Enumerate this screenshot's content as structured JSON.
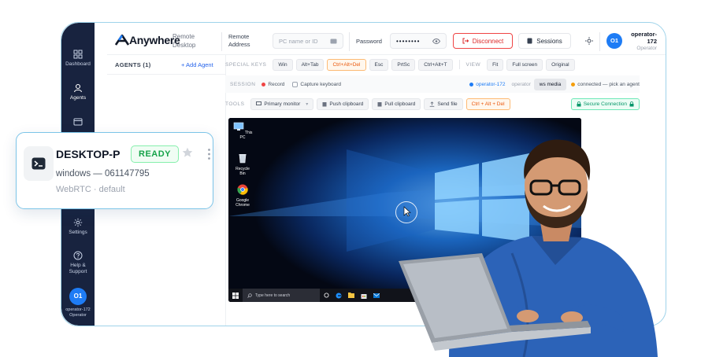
{
  "header": {
    "brand": "Anywhere",
    "brand_sub": "Remote Desktop",
    "remote_address_label": "Remote Address",
    "remote_address_placeholder": "PC name or ID",
    "password_label": "Password",
    "password_value": "••••••••",
    "disconnect_label": "Disconnect",
    "sessions_label": "Sessions",
    "avatar_initials": "O1",
    "user_name": "operator-172",
    "user_role": "Operator"
  },
  "sidebar": {
    "items": [
      {
        "label": "Dashboard",
        "icon": "grid-icon"
      },
      {
        "label": "Agents",
        "icon": "user-icon"
      },
      {
        "label": "Sessions",
        "icon": "window-icon"
      },
      {
        "label": "Settings",
        "icon": "gear-icon"
      },
      {
        "label": "Help & Support",
        "icon": "help-icon"
      }
    ],
    "avatar_initials": "O1",
    "user_name": "operator-172",
    "user_role": "Operator"
  },
  "agents_panel": {
    "title": "AGENTS (1)",
    "add_label": "+ Add Agent"
  },
  "special_keys": {
    "label": "SPECIAL KEYS",
    "keys": [
      "Win",
      "Alt+Tab",
      "Ctrl+Alt+Del",
      "Esc",
      "PrtSc",
      "Ctrl+Alt+T"
    ],
    "view_label": "VIEW",
    "view_options": [
      "Fit",
      "Full screen",
      "Original"
    ]
  },
  "session": {
    "label": "SESSION",
    "record_label": "Record",
    "capture_label": "Capture keyboard",
    "operator_name": "operator-172",
    "operator_role": "operator",
    "media_label": "ws media",
    "status_text": "connected — pick an agent"
  },
  "tools": {
    "label": "TOOLS",
    "monitor_label": "Primary monitor",
    "push_label": "Push clipboard",
    "pull_label": "Pull clipboard",
    "send_label": "Send file",
    "cad_label": "Ctrl + Alt + Del",
    "secure_label": "Secure Connection"
  },
  "desktop": {
    "icons": [
      "This PC",
      "Recycle Bin",
      "Google Chrome"
    ],
    "search_placeholder": "Type here to search"
  },
  "agent_card": {
    "name": "DESKTOP-P",
    "status": "READY",
    "os_line": "windows — 061147795",
    "transport_line": "WebRTC · default"
  },
  "colors": {
    "sidebar": "#18233f",
    "accent": "#1e7cf5",
    "danger": "#dc2626",
    "warning": "#ea580c",
    "success": "#16a34a"
  }
}
